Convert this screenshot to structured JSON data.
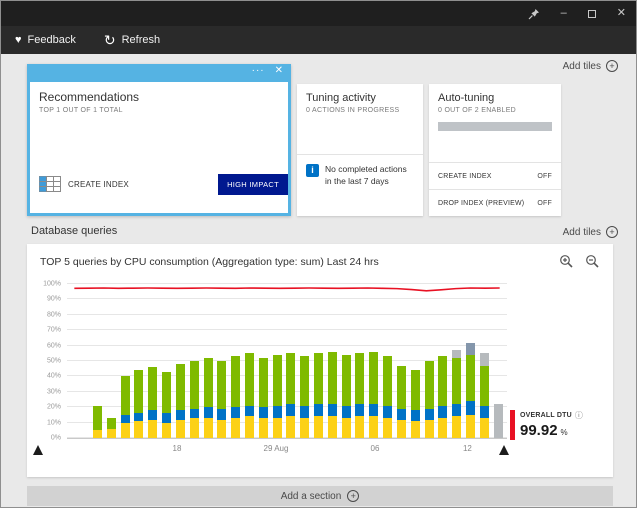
{
  "icons": {
    "heart": "♥",
    "refresh": "↻",
    "plus": "+",
    "minimize": "–",
    "close": "✕",
    "ellipsis": "···",
    "tile_close": "✕",
    "info": "i",
    "info_circle": "ⓘ"
  },
  "toolbar": {
    "feedback_label": "Feedback",
    "refresh_label": "Refresh"
  },
  "tiles_header": {
    "add_tiles_label": "Add tiles"
  },
  "recommendations_tile": {
    "title": "Recommendations",
    "subtitle": "TOP 1 OUT OF 1 TOTAL",
    "recommendation": {
      "name": "CREATE INDEX",
      "impact": "HIGH IMPACT"
    }
  },
  "tuning_activity_tile": {
    "title": "Tuning activity",
    "status": "0 ACTIONS IN PROGRESS",
    "message": "No completed actions in the last 7 days"
  },
  "auto_tuning_tile": {
    "title": "Auto-tuning",
    "status": "0 OUT OF 2 ENABLED",
    "options": [
      {
        "label": "CREATE INDEX",
        "value": "OFF"
      },
      {
        "label": "DROP INDEX (PREVIEW)",
        "value": "OFF"
      }
    ]
  },
  "queries_section": {
    "title": "Database queries",
    "add_tiles_label": "Add tiles",
    "footer_label": "Add a section"
  },
  "dtu_legend": {
    "label": "OVERALL DTU",
    "value": "99.92",
    "unit": "%"
  },
  "colors": {
    "selection_blue": "#55b3e3",
    "impact_badge_blue": "#00188f",
    "info_blue": "#0072c6",
    "dtu_red": "#e81123"
  },
  "chart_data": {
    "type": "bar",
    "stacked": true,
    "title": "TOP 5 queries by CPU consumption (Aggregation type: sum) Last 24 hrs",
    "ylim": [
      0,
      100
    ],
    "grid": true,
    "yticks": [
      "0%",
      "10%",
      "20%",
      "30%",
      "40%",
      "50%",
      "60%",
      "70%",
      "80%",
      "90%",
      "100%"
    ],
    "xticks": [
      {
        "label": "18",
        "pos": 0.25
      },
      {
        "label": "29 Aug",
        "pos": 0.475
      },
      {
        "label": "06",
        "pos": 0.7
      },
      {
        "label": "12",
        "pos": 0.91
      }
    ],
    "palette": {
      "yellow": "#fcd116",
      "green": "#7fba00",
      "blue": "#0072c6",
      "gray": "#b6babd",
      "slate": "#8496ab"
    },
    "overall_dtu_line": {
      "name": "OVERALL DTU",
      "color": "#e81123",
      "value_pct": 99.92,
      "values": [
        97.2,
        97.3,
        97.4,
        97.2,
        97.3,
        97.4,
        97.3,
        97.2,
        97.3,
        97.4,
        97.3,
        97.2,
        97.4,
        97.3,
        97.2,
        97.3,
        97.4,
        97.3,
        97.2,
        97.3,
        97.4,
        97.2,
        97.0,
        96.4,
        95.6,
        96.2,
        97.0,
        97.4,
        97.3,
        97.4
      ]
    },
    "bars": [
      {
        "segments": [
          {
            "c": "yellow",
            "v": 5
          },
          {
            "c": "green",
            "v": 16
          }
        ]
      },
      {
        "segments": [
          {
            "c": "yellow",
            "v": 6
          },
          {
            "c": "green",
            "v": 7
          }
        ]
      },
      {
        "segments": [
          {
            "c": "yellow",
            "v": 10
          },
          {
            "c": "blue",
            "v": 5
          },
          {
            "c": "green",
            "v": 25
          }
        ]
      },
      {
        "segments": [
          {
            "c": "yellow",
            "v": 11
          },
          {
            "c": "blue",
            "v": 5
          },
          {
            "c": "green",
            "v": 28
          }
        ]
      },
      {
        "segments": [
          {
            "c": "yellow",
            "v": 12
          },
          {
            "c": "blue",
            "v": 6
          },
          {
            "c": "green",
            "v": 28
          }
        ]
      },
      {
        "segments": [
          {
            "c": "yellow",
            "v": 10
          },
          {
            "c": "blue",
            "v": 6
          },
          {
            "c": "green",
            "v": 27
          }
        ]
      },
      {
        "segments": [
          {
            "c": "yellow",
            "v": 12
          },
          {
            "c": "blue",
            "v": 6
          },
          {
            "c": "green",
            "v": 30
          }
        ]
      },
      {
        "segments": [
          {
            "c": "yellow",
            "v": 13
          },
          {
            "c": "blue",
            "v": 6
          },
          {
            "c": "green",
            "v": 31
          }
        ]
      },
      {
        "segments": [
          {
            "c": "yellow",
            "v": 13
          },
          {
            "c": "blue",
            "v": 7
          },
          {
            "c": "green",
            "v": 32
          }
        ]
      },
      {
        "segments": [
          {
            "c": "yellow",
            "v": 12
          },
          {
            "c": "blue",
            "v": 7
          },
          {
            "c": "green",
            "v": 31
          }
        ]
      },
      {
        "segments": [
          {
            "c": "yellow",
            "v": 13
          },
          {
            "c": "blue",
            "v": 7
          },
          {
            "c": "green",
            "v": 33
          }
        ]
      },
      {
        "segments": [
          {
            "c": "yellow",
            "v": 14
          },
          {
            "c": "blue",
            "v": 7
          },
          {
            "c": "green",
            "v": 34
          }
        ]
      },
      {
        "segments": [
          {
            "c": "yellow",
            "v": 13
          },
          {
            "c": "blue",
            "v": 7
          },
          {
            "c": "green",
            "v": 32
          }
        ]
      },
      {
        "segments": [
          {
            "c": "yellow",
            "v": 13
          },
          {
            "c": "blue",
            "v": 8
          },
          {
            "c": "green",
            "v": 33
          }
        ]
      },
      {
        "segments": [
          {
            "c": "yellow",
            "v": 14
          },
          {
            "c": "blue",
            "v": 8
          },
          {
            "c": "green",
            "v": 33
          }
        ]
      },
      {
        "segments": [
          {
            "c": "yellow",
            "v": 13
          },
          {
            "c": "blue",
            "v": 8
          },
          {
            "c": "green",
            "v": 32
          }
        ]
      },
      {
        "segments": [
          {
            "c": "yellow",
            "v": 14
          },
          {
            "c": "blue",
            "v": 8
          },
          {
            "c": "green",
            "v": 33
          }
        ]
      },
      {
        "segments": [
          {
            "c": "yellow",
            "v": 14
          },
          {
            "c": "blue",
            "v": 8
          },
          {
            "c": "green",
            "v": 34
          }
        ]
      },
      {
        "segments": [
          {
            "c": "yellow",
            "v": 13
          },
          {
            "c": "blue",
            "v": 8
          },
          {
            "c": "green",
            "v": 33
          }
        ]
      },
      {
        "segments": [
          {
            "c": "yellow",
            "v": 14
          },
          {
            "c": "blue",
            "v": 8
          },
          {
            "c": "green",
            "v": 33
          }
        ]
      },
      {
        "segments": [
          {
            "c": "yellow",
            "v": 14
          },
          {
            "c": "blue",
            "v": 8
          },
          {
            "c": "green",
            "v": 34
          }
        ]
      },
      {
        "segments": [
          {
            "c": "yellow",
            "v": 13
          },
          {
            "c": "blue",
            "v": 8
          },
          {
            "c": "green",
            "v": 32
          }
        ]
      },
      {
        "segments": [
          {
            "c": "yellow",
            "v": 12
          },
          {
            "c": "blue",
            "v": 7
          },
          {
            "c": "green",
            "v": 28
          }
        ]
      },
      {
        "segments": [
          {
            "c": "yellow",
            "v": 11
          },
          {
            "c": "blue",
            "v": 7
          },
          {
            "c": "green",
            "v": 26
          }
        ]
      },
      {
        "segments": [
          {
            "c": "yellow",
            "v": 12
          },
          {
            "c": "blue",
            "v": 7
          },
          {
            "c": "green",
            "v": 31
          }
        ]
      },
      {
        "segments": [
          {
            "c": "yellow",
            "v": 13
          },
          {
            "c": "blue",
            "v": 8
          },
          {
            "c": "green",
            "v": 32
          }
        ]
      },
      {
        "segments": [
          {
            "c": "yellow",
            "v": 14
          },
          {
            "c": "blue",
            "v": 8
          },
          {
            "c": "green",
            "v": 30
          },
          {
            "c": "gray",
            "v": 5
          }
        ]
      },
      {
        "segments": [
          {
            "c": "yellow",
            "v": 15
          },
          {
            "c": "blue",
            "v": 9
          },
          {
            "c": "green",
            "v": 30
          },
          {
            "c": "slate",
            "v": 8
          }
        ]
      },
      {
        "segments": [
          {
            "c": "yellow",
            "v": 13
          },
          {
            "c": "blue",
            "v": 8
          },
          {
            "c": "green",
            "v": 26
          },
          {
            "c": "gray",
            "v": 8
          }
        ]
      },
      {
        "segments": [
          {
            "c": "gray",
            "v": 22
          }
        ]
      }
    ]
  }
}
